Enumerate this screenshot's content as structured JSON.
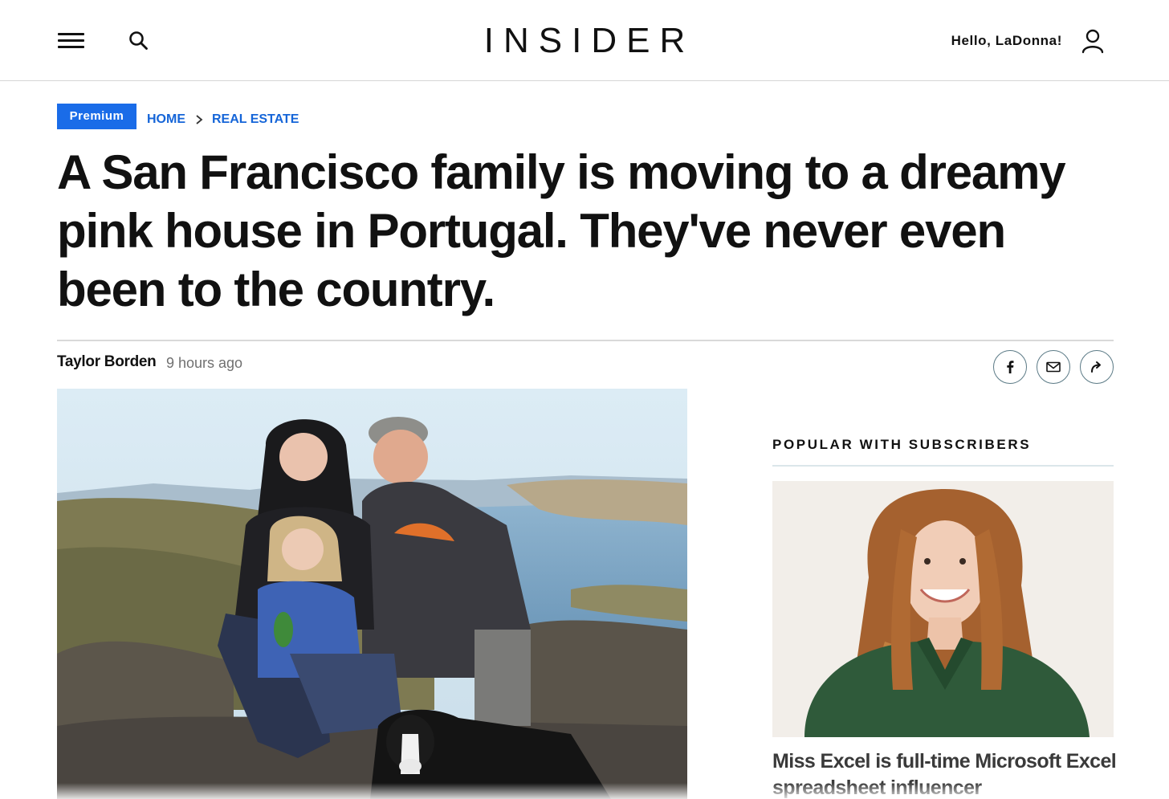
{
  "header": {
    "logo": "INSIDER",
    "greeting": "Hello, LaDonna!",
    "icons": {
      "menu": "hamburger-menu-icon",
      "search": "search-icon",
      "account": "user-account-icon"
    }
  },
  "breadcrumb": {
    "badge": "Premium",
    "home": "HOME",
    "section": "REAL ESTATE"
  },
  "article": {
    "headline": "A San Francisco family is moving to a dreamy pink house in Portugal. They've never even been to the country.",
    "author": "Taylor Borden",
    "time": "9 hours ago",
    "share": [
      "facebook-icon",
      "email-icon",
      "share-forward-icon"
    ]
  },
  "sidebar": {
    "title": "POPULAR WITH SUBSCRIBERS",
    "story_headline": "Miss Excel is full-time Microsoft Excel spreadsheet influencer"
  },
  "colors": {
    "accent_blue": "#1a6ce8",
    "link_blue": "#1565d8",
    "text": "#111111",
    "muted": "#707070",
    "share_border": "#5b7a86"
  }
}
